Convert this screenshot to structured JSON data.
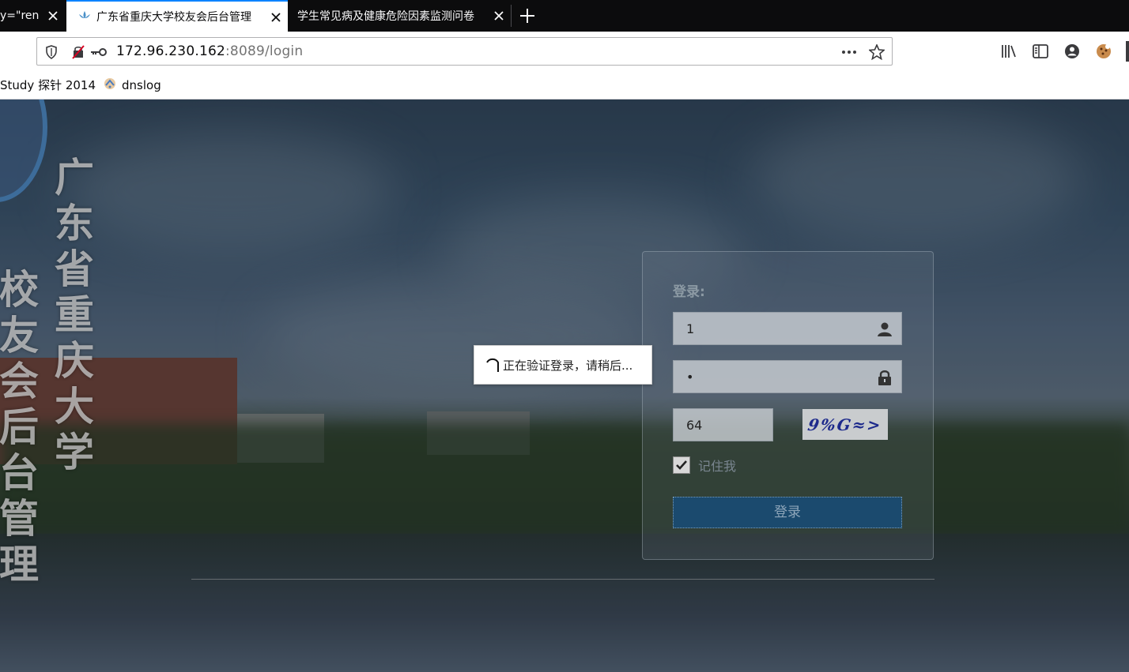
{
  "browser": {
    "tabs": [
      {
        "label": "y=\"ren",
        "active": false
      },
      {
        "label": "广东省重庆大学校友会后台管理",
        "active": true
      },
      {
        "label": "学生常见病及健康危险因素监测问卷",
        "active": false
      }
    ],
    "url": {
      "host": "172.96.230.162",
      "rest": ":8089/login"
    },
    "bookmarks": [
      {
        "label": "Study 探针 2014",
        "icon": ""
      },
      {
        "label": "dnslog",
        "icon": "dnslog-icon"
      }
    ],
    "accent_color": "#0a84ff"
  },
  "page": {
    "vertical_title_1": "广东省重庆大学",
    "vertical_title_2": "校友会后台管理",
    "login": {
      "title": "登录:",
      "username_value": "1",
      "password_value": "•",
      "captcha_value": "64",
      "captcha_text": "9%G≈>",
      "remember_label": "记住我",
      "remember_checked": true,
      "submit_label": "登录"
    },
    "toast": {
      "message": "正在验证登录，请稍后..."
    }
  }
}
